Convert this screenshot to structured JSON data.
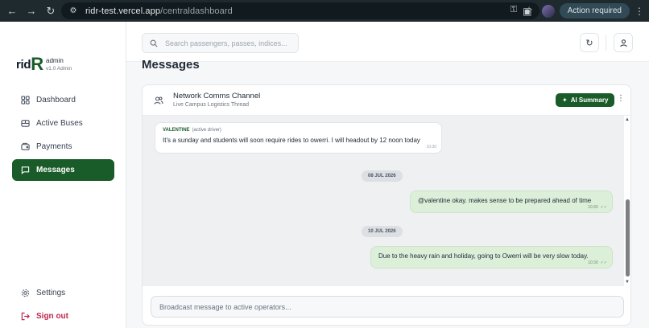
{
  "browser": {
    "url_host": "ridr-test.vercel.app",
    "url_path": "/centraldashboard",
    "action_required": "Action required"
  },
  "brand": {
    "logo_prefix": "rid",
    "logo_letter": "R",
    "user": "admin",
    "version": "v1.0 Admin"
  },
  "sidebar": {
    "items": [
      {
        "label": "Dashboard",
        "icon": "grid-icon"
      },
      {
        "label": "Active Buses",
        "icon": "bus-icon"
      },
      {
        "label": "Payments",
        "icon": "wallet-icon"
      },
      {
        "label": "Messages",
        "icon": "message-icon",
        "active": true
      }
    ],
    "settings": "Settings",
    "sign_out": "Sign out"
  },
  "header": {
    "search_placeholder": "Search passengers, passes, indices..."
  },
  "page": {
    "title": "Messages"
  },
  "channel": {
    "title": "Network Comms Channel",
    "subtitle": "Live Campus Logistics Thread",
    "ai_summary": "AI Summary"
  },
  "thread": {
    "incoming": {
      "sender": "VALENTINE",
      "role": "(active driver)",
      "text": "It's a sunday and students will soon require rides to owerri. I will headout by 12 noon today",
      "time": "10:30"
    },
    "date1": "08 JUL 2026",
    "outgoing1": {
      "text": "@valentine okay. makes sense to be prepared ahead of time",
      "time": "10:30"
    },
    "date2": "10 JUL 2026",
    "outgoing2": {
      "text": "Due to the heavy rain and holiday, going to Owerri will be very slow today.",
      "time": "10:30"
    }
  },
  "composer": {
    "placeholder": "Broadcast message to active operators..."
  },
  "colors": {
    "brand_green": "#1a5b2a",
    "sign_out_red": "#c0264b",
    "outgoing_bubble": "#dcefd9"
  }
}
